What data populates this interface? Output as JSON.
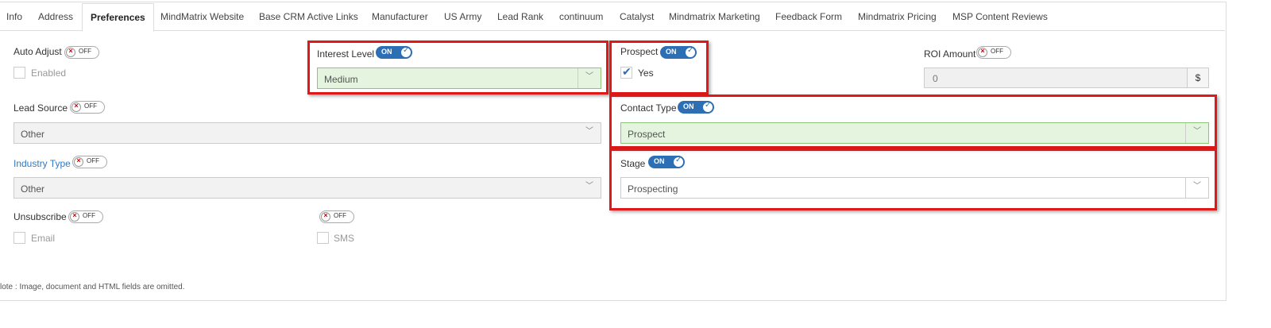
{
  "tabs": [
    {
      "label": "Info"
    },
    {
      "label": "Address"
    },
    {
      "label": "Preferences"
    },
    {
      "label": "MindMatrix Website"
    },
    {
      "label": "Base CRM Active Links"
    },
    {
      "label": "Manufacturer"
    },
    {
      "label": "US Army"
    },
    {
      "label": "Lead Rank"
    },
    {
      "label": "continuum"
    },
    {
      "label": "Catalyst"
    },
    {
      "label": "Mindmatrix Marketing"
    },
    {
      "label": "Feedback Form"
    },
    {
      "label": "Mindmatrix Pricing"
    },
    {
      "label": "MSP Content Reviews"
    }
  ],
  "active_tab": "Preferences",
  "toggle": {
    "on": "ON",
    "off": "OFF"
  },
  "fields": {
    "auto_adjust": {
      "label": "Auto Adjust",
      "checkbox_label": "Enabled",
      "checked": false
    },
    "interest_level": {
      "label": "Interest Level",
      "value": "Medium"
    },
    "prospect": {
      "label": "Prospect",
      "checkbox_label": "Yes",
      "checked": true
    },
    "roi_amount": {
      "label": "ROI Amount",
      "value": "0",
      "addon": "$"
    },
    "lead_source": {
      "label": "Lead Source",
      "value": "Other"
    },
    "contact_type": {
      "label": "Contact Type",
      "value": "Prospect"
    },
    "industry_type": {
      "label": "Industry Type",
      "value": "Other"
    },
    "stage": {
      "label": "Stage",
      "value": "Prospecting"
    },
    "unsubscribe": {
      "label": "Unsubscribe",
      "email_label": "Email",
      "sms_label": "SMS"
    }
  },
  "note": "lote : Image, document and HTML fields are omitted.",
  "colors": {
    "highlight": "#e01818",
    "toggle_on": "#2c6fb5",
    "link": "#2f7ac4",
    "green_field": "#e4f4df"
  }
}
